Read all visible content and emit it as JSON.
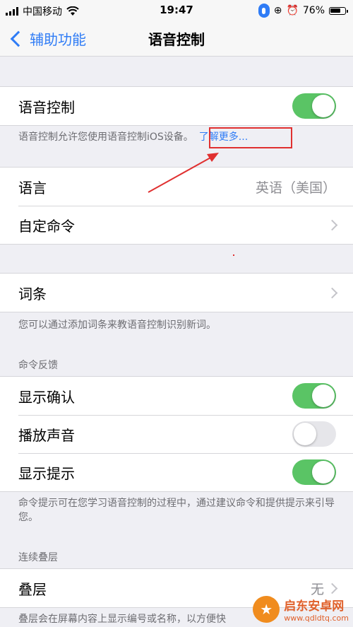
{
  "status_bar": {
    "carrier": "中国移动",
    "time": "19:47",
    "battery_percent": "76%",
    "battery_level": 0.76
  },
  "nav": {
    "back_label": "辅助功能",
    "title": "语音控制"
  },
  "voice_control": {
    "label": "语音控制",
    "enabled": true,
    "footnote": "语音控制允许您使用语音控制iOS设备。",
    "learn_more": "了解更多..."
  },
  "language": {
    "label": "语言",
    "value": "英语（美国）"
  },
  "custom_commands": {
    "label": "自定命令"
  },
  "vocabulary": {
    "label": "词条",
    "footnote": "您可以通过添加词条来教语音控制识别新词。"
  },
  "command_feedback": {
    "header": "命令反馈",
    "items": [
      {
        "label": "显示确认",
        "enabled": true
      },
      {
        "label": "播放声音",
        "enabled": false
      },
      {
        "label": "显示提示",
        "enabled": true
      }
    ],
    "footnote": "命令提示可在您学习语音控制的过程中，通过建议命令和提供提示来引导您。"
  },
  "continuous_overlay": {
    "header": "连续叠层",
    "label": "叠层",
    "value": "无",
    "footnote": "叠层会在屏幕内容上显示编号或名称，以方便快"
  },
  "watermark": {
    "name": "启东安卓网",
    "url": "www.qdldtq.com"
  },
  "colors": {
    "accent": "#2f7cf6",
    "toggle_on": "#5ac465",
    "annotation": "#e03030"
  }
}
